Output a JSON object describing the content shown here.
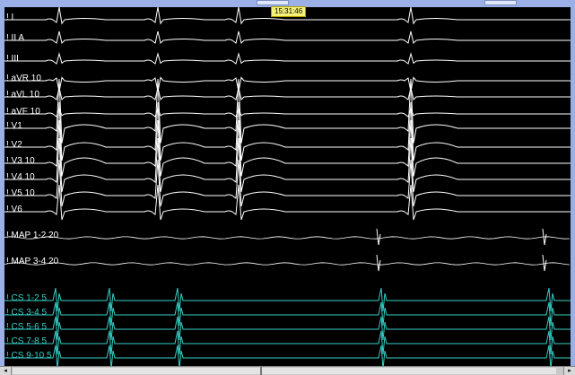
{
  "timestamp": "15:31:46",
  "leads": [
    {
      "label": "! I",
      "kind": "ecg"
    },
    {
      "label": "! II   A",
      "kind": "ecg"
    },
    {
      "label": "! III",
      "kind": "ecg"
    },
    {
      "label": "! aVR  10",
      "kind": "ecg"
    },
    {
      "label": "! aVL  10",
      "kind": "ecg"
    },
    {
      "label": "! aVF  10",
      "kind": "ecg"
    },
    {
      "label": "! V1",
      "kind": "ecg"
    },
    {
      "label": "! V2",
      "kind": "ecg"
    },
    {
      "label": "! V3  10",
      "kind": "ecg"
    },
    {
      "label": "! V4  10",
      "kind": "ecg"
    },
    {
      "label": "! V5  10",
      "kind": "ecg"
    },
    {
      "label": "! V6",
      "kind": "ecg"
    },
    {
      "label": "! MAP 1-2  20",
      "kind": "ecg"
    },
    {
      "label": "! MAP 3-4  20",
      "kind": "ecg"
    },
    {
      "label": "! CS 1-2  5",
      "kind": "cs"
    },
    {
      "label": "! CS 3-4  5",
      "kind": "cs"
    },
    {
      "label": "! CS 5-6  5",
      "kind": "cs"
    },
    {
      "label": "! CS 7-8  5",
      "kind": "cs"
    },
    {
      "label": "! CS 9-10  5",
      "kind": "cs"
    }
  ],
  "colors": {
    "ecg": "#ffffff",
    "cs": "#36d0c8",
    "frame": "#9bb0e6",
    "timestamp_bg": "#f5f07a"
  },
  "scrollbar": {
    "left_arrow": "◂",
    "right_arrow": "▸"
  }
}
